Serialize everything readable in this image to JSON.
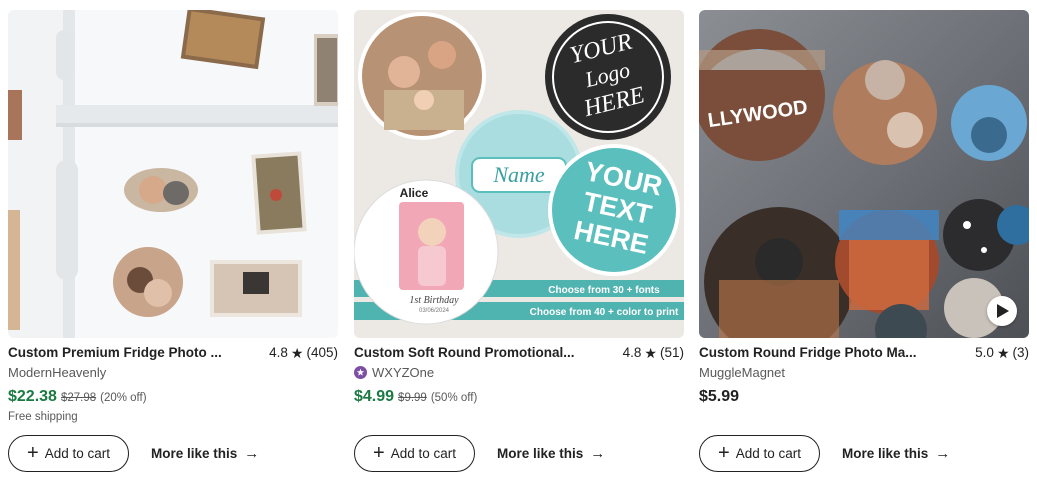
{
  "listings": [
    {
      "title": "Custom Premium Fridge Photo ...",
      "rating": "4.8",
      "reviews": "(405)",
      "shop": "ModernHeavenly",
      "price": "$22.38",
      "original_price": "$27.98",
      "discount": "(20% off)",
      "shipping": "Free shipping",
      "add_label": "Add to cart",
      "more_label": "More like this"
    },
    {
      "title": "Custom Soft Round Promotional...",
      "rating": "4.8",
      "reviews": "(51)",
      "shop": "WXYZOne",
      "price": "$4.99",
      "original_price": "$9.99",
      "discount": "(50% off)",
      "add_label": "Add to cart",
      "more_label": "More like this",
      "image_text": {
        "logo_line1": "YOUR",
        "logo_line2": "Logo",
        "logo_line3": "HERE",
        "name_tag": "Name",
        "text_line1": "YOUR",
        "text_line2": "TEXT",
        "text_line3": "HERE",
        "child_name": "Alice",
        "birthday": "1st Birthday",
        "date": "03/06/2024",
        "banner1": "Choose from 30 + fonts",
        "banner2": "Choose from 40 + color to print"
      }
    },
    {
      "title": "Custom Round Fridge Photo Ma...",
      "rating": "5.0",
      "reviews": "(3)",
      "shop": "MuggleMagnet",
      "price": "$5.99",
      "add_label": "Add to cart",
      "more_label": "More like this",
      "image_text": {
        "sign": "LLYWOOD"
      }
    }
  ],
  "icons": {
    "star": "star-icon",
    "plus": "plus-icon",
    "arrow": "arrow-right-icon",
    "play": "play-icon",
    "shop_badge": "star-seller-badge-icon"
  },
  "colors": {
    "sale_price": "#1b7a43",
    "text": "#222222",
    "muted": "#595959",
    "teal": "#5bbfbd",
    "badge": "#7b4fa6"
  }
}
